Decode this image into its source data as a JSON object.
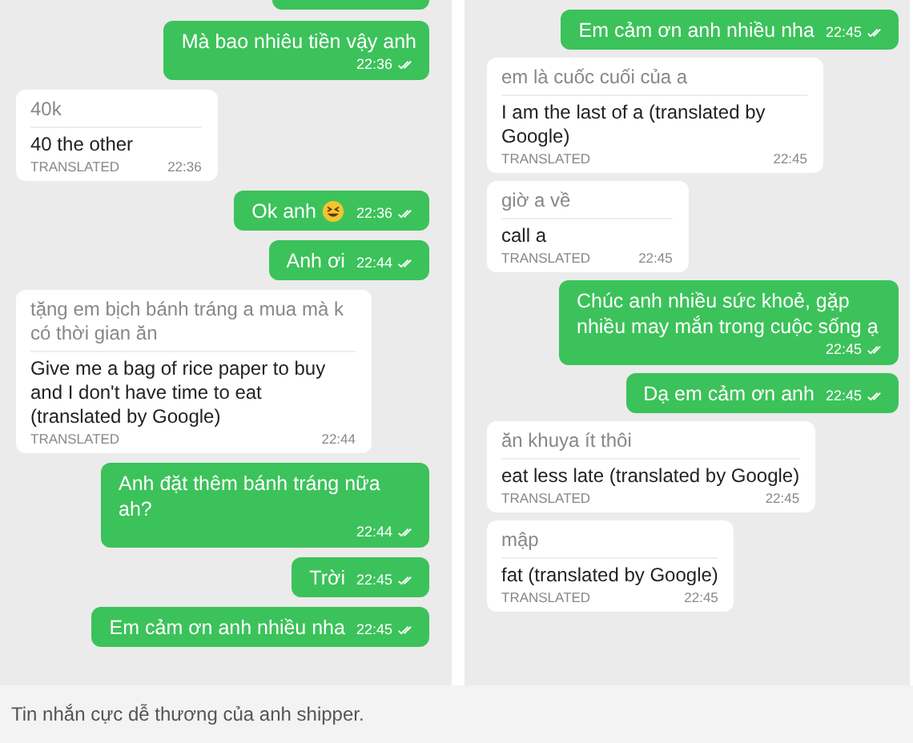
{
  "panels": [
    {
      "messages": [
        {
          "kind": "cut_off"
        },
        {
          "kind": "sent",
          "text": "Mà bao nhiêu tiền vậy anh",
          "time": "22:36",
          "read": true,
          "time_below": true,
          "has_emoji": false
        },
        {
          "kind": "received",
          "original": "40k",
          "translation": "40 the other",
          "label": "TRANSLATED",
          "time": "22:36"
        },
        {
          "kind": "sent",
          "text": "Ok anh",
          "time": "22:36",
          "read": true,
          "time_below": false,
          "has_emoji": true
        },
        {
          "kind": "sent",
          "text": "Anh ơi",
          "time": "22:44",
          "read": true,
          "time_below": false,
          "has_emoji": false
        },
        {
          "kind": "received",
          "original": "tặng em bịch bánh tráng a mua mà k có thời gian ăn",
          "translation": "Give me a bag of rice paper to buy and I don't have time to eat (translated by Google)",
          "label": "TRANSLATED",
          "time": "22:44"
        },
        {
          "kind": "sent",
          "text": "Anh đặt thêm bánh tráng nữa ah?",
          "time": "22:44",
          "read": true,
          "time_below": true,
          "has_emoji": false
        },
        {
          "kind": "sent",
          "text": "Trời",
          "time": "22:45",
          "read": true,
          "time_below": false,
          "has_emoji": false
        },
        {
          "kind": "sent",
          "text": "Em cảm ơn anh nhiều nha",
          "time": "22:45",
          "read": true,
          "time_below": false,
          "has_emoji": false
        }
      ]
    },
    {
      "messages": [
        {
          "kind": "sent",
          "text": "Em cảm ơn anh nhiều nha",
          "time": "22:45",
          "read": true,
          "time_below": false,
          "has_emoji": false
        },
        {
          "kind": "received",
          "original": "em là cuốc cuối của a",
          "translation": "I am the last of a (translated by Google)",
          "label": "TRANSLATED",
          "time": "22:45"
        },
        {
          "kind": "received",
          "original": "giờ a về",
          "translation": "call a",
          "label": "TRANSLATED",
          "time": "22:45"
        },
        {
          "kind": "sent",
          "text": "Chúc anh nhiều sức khoẻ, gặp nhiều may mắn trong cuộc sống ạ",
          "time": "22:45",
          "read": true,
          "time_below": true,
          "has_emoji": false
        },
        {
          "kind": "sent",
          "text": "Dạ em cảm ơn anh",
          "time": "22:45",
          "read": true,
          "time_below": false,
          "has_emoji": false
        },
        {
          "kind": "received",
          "original": "ăn khuya ít thôi",
          "translation": "eat less late (translated by Google)",
          "label": "TRANSLATED",
          "time": "22:45"
        },
        {
          "kind": "received",
          "original": "mập",
          "translation": "fat (translated by Google)",
          "label": "TRANSLATED",
          "time": "22:45"
        }
      ]
    }
  ],
  "caption": "Tin nhắn cực dễ thương của anh shipper."
}
